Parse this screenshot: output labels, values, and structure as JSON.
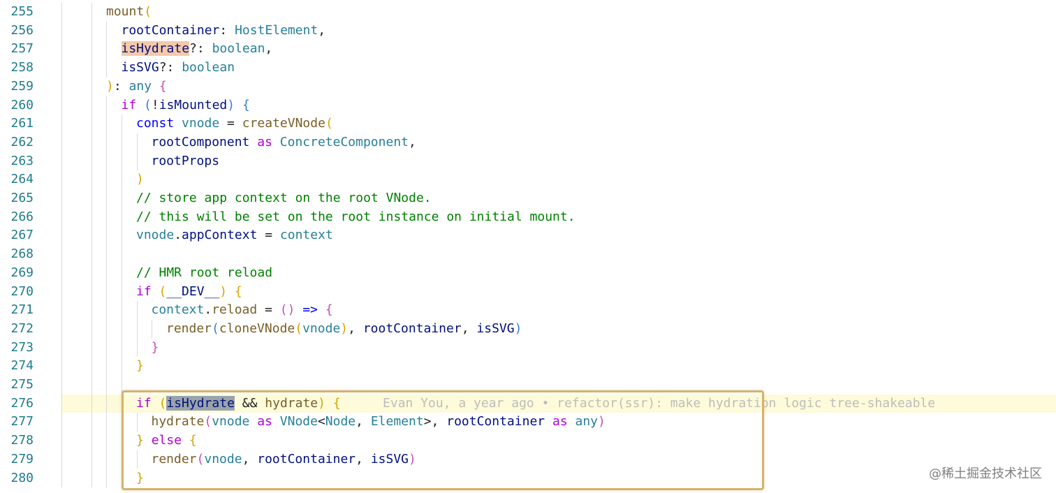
{
  "editor": {
    "lines": [
      {
        "number": "255",
        "indent": 0,
        "tokens": [
          {
            "t": "mount",
            "c": "fn"
          },
          {
            "t": "(",
            "c": "b1"
          }
        ]
      },
      {
        "number": "256",
        "indent": 1,
        "tokens": [
          {
            "t": "rootContainer",
            "c": "v"
          },
          {
            "t": ": ",
            "c": "p"
          },
          {
            "t": "HostElement",
            "c": "ty"
          },
          {
            "t": ",",
            "c": "p"
          }
        ]
      },
      {
        "number": "257",
        "indent": 1,
        "tokens": [
          {
            "t": "isHydrate",
            "c": "v hl-occ"
          },
          {
            "t": "?: ",
            "c": "p"
          },
          {
            "t": "boolean",
            "c": "ty"
          },
          {
            "t": ",",
            "c": "p"
          }
        ]
      },
      {
        "number": "258",
        "indent": 1,
        "tokens": [
          {
            "t": "isSVG",
            "c": "v"
          },
          {
            "t": "?: ",
            "c": "p"
          },
          {
            "t": "boolean",
            "c": "ty"
          }
        ]
      },
      {
        "number": "259",
        "indent": 0,
        "tokens": [
          {
            "t": ")",
            "c": "b1"
          },
          {
            "t": ": ",
            "c": "p"
          },
          {
            "t": "any",
            "c": "ty"
          },
          {
            "t": " ",
            "c": "p"
          },
          {
            "t": "{",
            "c": "b2"
          }
        ]
      },
      {
        "number": "260",
        "indent": 1,
        "tokens": [
          {
            "t": "if",
            "c": "k"
          },
          {
            "t": " ",
            "c": "p"
          },
          {
            "t": "(",
            "c": "b3"
          },
          {
            "t": "!",
            "c": "p"
          },
          {
            "t": "isMounted",
            "c": "v"
          },
          {
            "t": ")",
            "c": "b3"
          },
          {
            "t": " ",
            "c": "p"
          },
          {
            "t": "{",
            "c": "b3"
          }
        ]
      },
      {
        "number": "261",
        "indent": 2,
        "tokens": [
          {
            "t": "const",
            "c": "kb"
          },
          {
            "t": " ",
            "c": "p"
          },
          {
            "t": "vnode",
            "c": "ty"
          },
          {
            "t": " = ",
            "c": "p"
          },
          {
            "t": "createVNode",
            "c": "fn"
          },
          {
            "t": "(",
            "c": "b1"
          }
        ]
      },
      {
        "number": "262",
        "indent": 3,
        "tokens": [
          {
            "t": "rootComponent",
            "c": "v"
          },
          {
            "t": " ",
            "c": "p"
          },
          {
            "t": "as",
            "c": "k"
          },
          {
            "t": " ",
            "c": "p"
          },
          {
            "t": "ConcreteComponent",
            "c": "ty"
          },
          {
            "t": ",",
            "c": "p"
          }
        ]
      },
      {
        "number": "263",
        "indent": 3,
        "tokens": [
          {
            "t": "rootProps",
            "c": "v"
          }
        ]
      },
      {
        "number": "264",
        "indent": 2,
        "tokens": [
          {
            "t": ")",
            "c": "b1"
          }
        ]
      },
      {
        "number": "265",
        "indent": 2,
        "tokens": [
          {
            "t": "// store app context on the root VNode.",
            "c": "c"
          }
        ]
      },
      {
        "number": "266",
        "indent": 2,
        "tokens": [
          {
            "t": "// this will be set on the root instance on initial mount.",
            "c": "c"
          }
        ]
      },
      {
        "number": "267",
        "indent": 2,
        "tokens": [
          {
            "t": "vnode",
            "c": "ty"
          },
          {
            "t": ".",
            "c": "p"
          },
          {
            "t": "appContext",
            "c": "v"
          },
          {
            "t": " = ",
            "c": "p"
          },
          {
            "t": "context",
            "c": "ty"
          }
        ]
      },
      {
        "number": "268",
        "indent": 2,
        "tokens": []
      },
      {
        "number": "269",
        "indent": 2,
        "tokens": [
          {
            "t": "// HMR root reload",
            "c": "c"
          }
        ]
      },
      {
        "number": "270",
        "indent": 2,
        "tokens": [
          {
            "t": "if",
            "c": "k"
          },
          {
            "t": " ",
            "c": "p"
          },
          {
            "t": "(",
            "c": "b1"
          },
          {
            "t": "__DEV__",
            "c": "v"
          },
          {
            "t": ")",
            "c": "b1"
          },
          {
            "t": " ",
            "c": "p"
          },
          {
            "t": "{",
            "c": "b1"
          }
        ]
      },
      {
        "number": "271",
        "indent": 3,
        "tokens": [
          {
            "t": "context",
            "c": "ty"
          },
          {
            "t": ".",
            "c": "p"
          },
          {
            "t": "reload",
            "c": "fn"
          },
          {
            "t": " = ",
            "c": "p"
          },
          {
            "t": "()",
            "c": "b2"
          },
          {
            "t": " ",
            "c": "p"
          },
          {
            "t": "=>",
            "c": "kb"
          },
          {
            "t": " ",
            "c": "p"
          },
          {
            "t": "{",
            "c": "b2"
          }
        ]
      },
      {
        "number": "272",
        "indent": 4,
        "tokens": [
          {
            "t": "render",
            "c": "fn"
          },
          {
            "t": "(",
            "c": "b3"
          },
          {
            "t": "cloneVNode",
            "c": "fn"
          },
          {
            "t": "(",
            "c": "b1"
          },
          {
            "t": "vnode",
            "c": "ty"
          },
          {
            "t": ")",
            "c": "b1"
          },
          {
            "t": ", ",
            "c": "p"
          },
          {
            "t": "rootContainer",
            "c": "v"
          },
          {
            "t": ", ",
            "c": "p"
          },
          {
            "t": "isSVG",
            "c": "v"
          },
          {
            "t": ")",
            "c": "b3"
          }
        ]
      },
      {
        "number": "273",
        "indent": 3,
        "tokens": [
          {
            "t": "}",
            "c": "b2"
          }
        ]
      },
      {
        "number": "274",
        "indent": 2,
        "tokens": [
          {
            "t": "}",
            "c": "b1"
          }
        ]
      },
      {
        "number": "275",
        "indent": 2,
        "tokens": []
      },
      {
        "number": "276",
        "indent": 2,
        "current": true,
        "tokens": [
          {
            "t": "if",
            "c": "k"
          },
          {
            "t": " ",
            "c": "p"
          },
          {
            "t": "(",
            "c": "b1"
          },
          {
            "t": "isHydrate",
            "c": "v hl-sel"
          },
          {
            "t": " && ",
            "c": "p"
          },
          {
            "t": "hydrate",
            "c": "fn"
          },
          {
            "t": ")",
            "c": "b1"
          },
          {
            "t": " ",
            "c": "p"
          },
          {
            "t": "{",
            "c": "b1"
          }
        ],
        "blame": "Evan You, a year ago • refactor(ssr): make hydration logic tree-shakeable"
      },
      {
        "number": "277",
        "indent": 3,
        "tokens": [
          {
            "t": "hydrate",
            "c": "fn"
          },
          {
            "t": "(",
            "c": "b2"
          },
          {
            "t": "vnode",
            "c": "ty"
          },
          {
            "t": " ",
            "c": "p"
          },
          {
            "t": "as",
            "c": "k"
          },
          {
            "t": " ",
            "c": "p"
          },
          {
            "t": "VNode",
            "c": "ty"
          },
          {
            "t": "<",
            "c": "p"
          },
          {
            "t": "Node",
            "c": "ty"
          },
          {
            "t": ", ",
            "c": "p"
          },
          {
            "t": "Element",
            "c": "ty"
          },
          {
            "t": ">",
            "c": "p"
          },
          {
            "t": ", ",
            "c": "p"
          },
          {
            "t": "rootContainer",
            "c": "v"
          },
          {
            "t": " ",
            "c": "p"
          },
          {
            "t": "as",
            "c": "k"
          },
          {
            "t": " ",
            "c": "p"
          },
          {
            "t": "any",
            "c": "ty"
          },
          {
            "t": ")",
            "c": "b2"
          }
        ]
      },
      {
        "number": "278",
        "indent": 2,
        "tokens": [
          {
            "t": "}",
            "c": "b1"
          },
          {
            "t": " ",
            "c": "p"
          },
          {
            "t": "else",
            "c": "k"
          },
          {
            "t": " ",
            "c": "p"
          },
          {
            "t": "{",
            "c": "b1"
          }
        ]
      },
      {
        "number": "279",
        "indent": 3,
        "tokens": [
          {
            "t": "render",
            "c": "fn"
          },
          {
            "t": "(",
            "c": "b2"
          },
          {
            "t": "vnode",
            "c": "ty"
          },
          {
            "t": ", ",
            "c": "p"
          },
          {
            "t": "rootContainer",
            "c": "v"
          },
          {
            "t": ", ",
            "c": "p"
          },
          {
            "t": "isSVG",
            "c": "v"
          },
          {
            "t": ")",
            "c": "b2"
          }
        ]
      },
      {
        "number": "280",
        "indent": 2,
        "tokens": [
          {
            "t": "}",
            "c": "b1"
          }
        ]
      }
    ]
  },
  "watermark": "@稀土掘金技术社区",
  "colors": {
    "line_number": "#1f7a8c",
    "keyword": "#af00db",
    "function": "#795e26",
    "variable": "#001080",
    "type": "#267f99",
    "comment": "#008000",
    "current_line_bg": "#fdfbd9",
    "annotation_border": "#d4b36a"
  }
}
